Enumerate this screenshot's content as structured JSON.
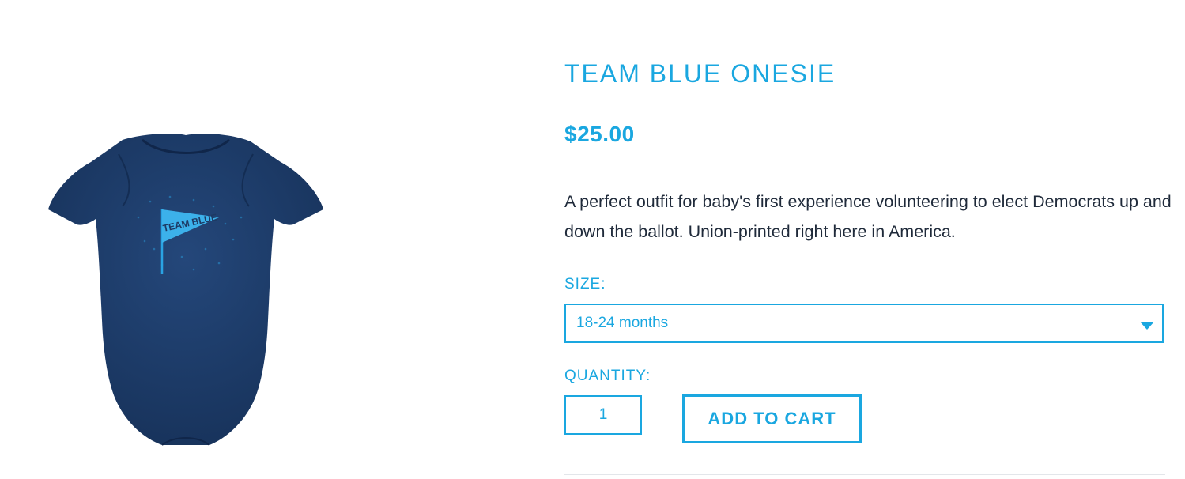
{
  "product": {
    "title": "TEAM BLUE ONESIE",
    "price": "$25.00",
    "description": "A perfect outfit for baby's first experience volunteering to elect Democrats up and down the ballot. Union-printed right here in America.",
    "image": {
      "icon": "onesie-image",
      "print_text": "TEAM BLUE",
      "garment_color": "#1d3a64",
      "print_color": "#2aa3e3"
    }
  },
  "size": {
    "label": "SIZE:",
    "selected": "18-24 months"
  },
  "quantity": {
    "label": "QUANTITY:",
    "value": "1"
  },
  "cart": {
    "add_label": "ADD TO CART"
  },
  "colors": {
    "accent": "#1aa7e0",
    "text": "#1f2a3a"
  }
}
